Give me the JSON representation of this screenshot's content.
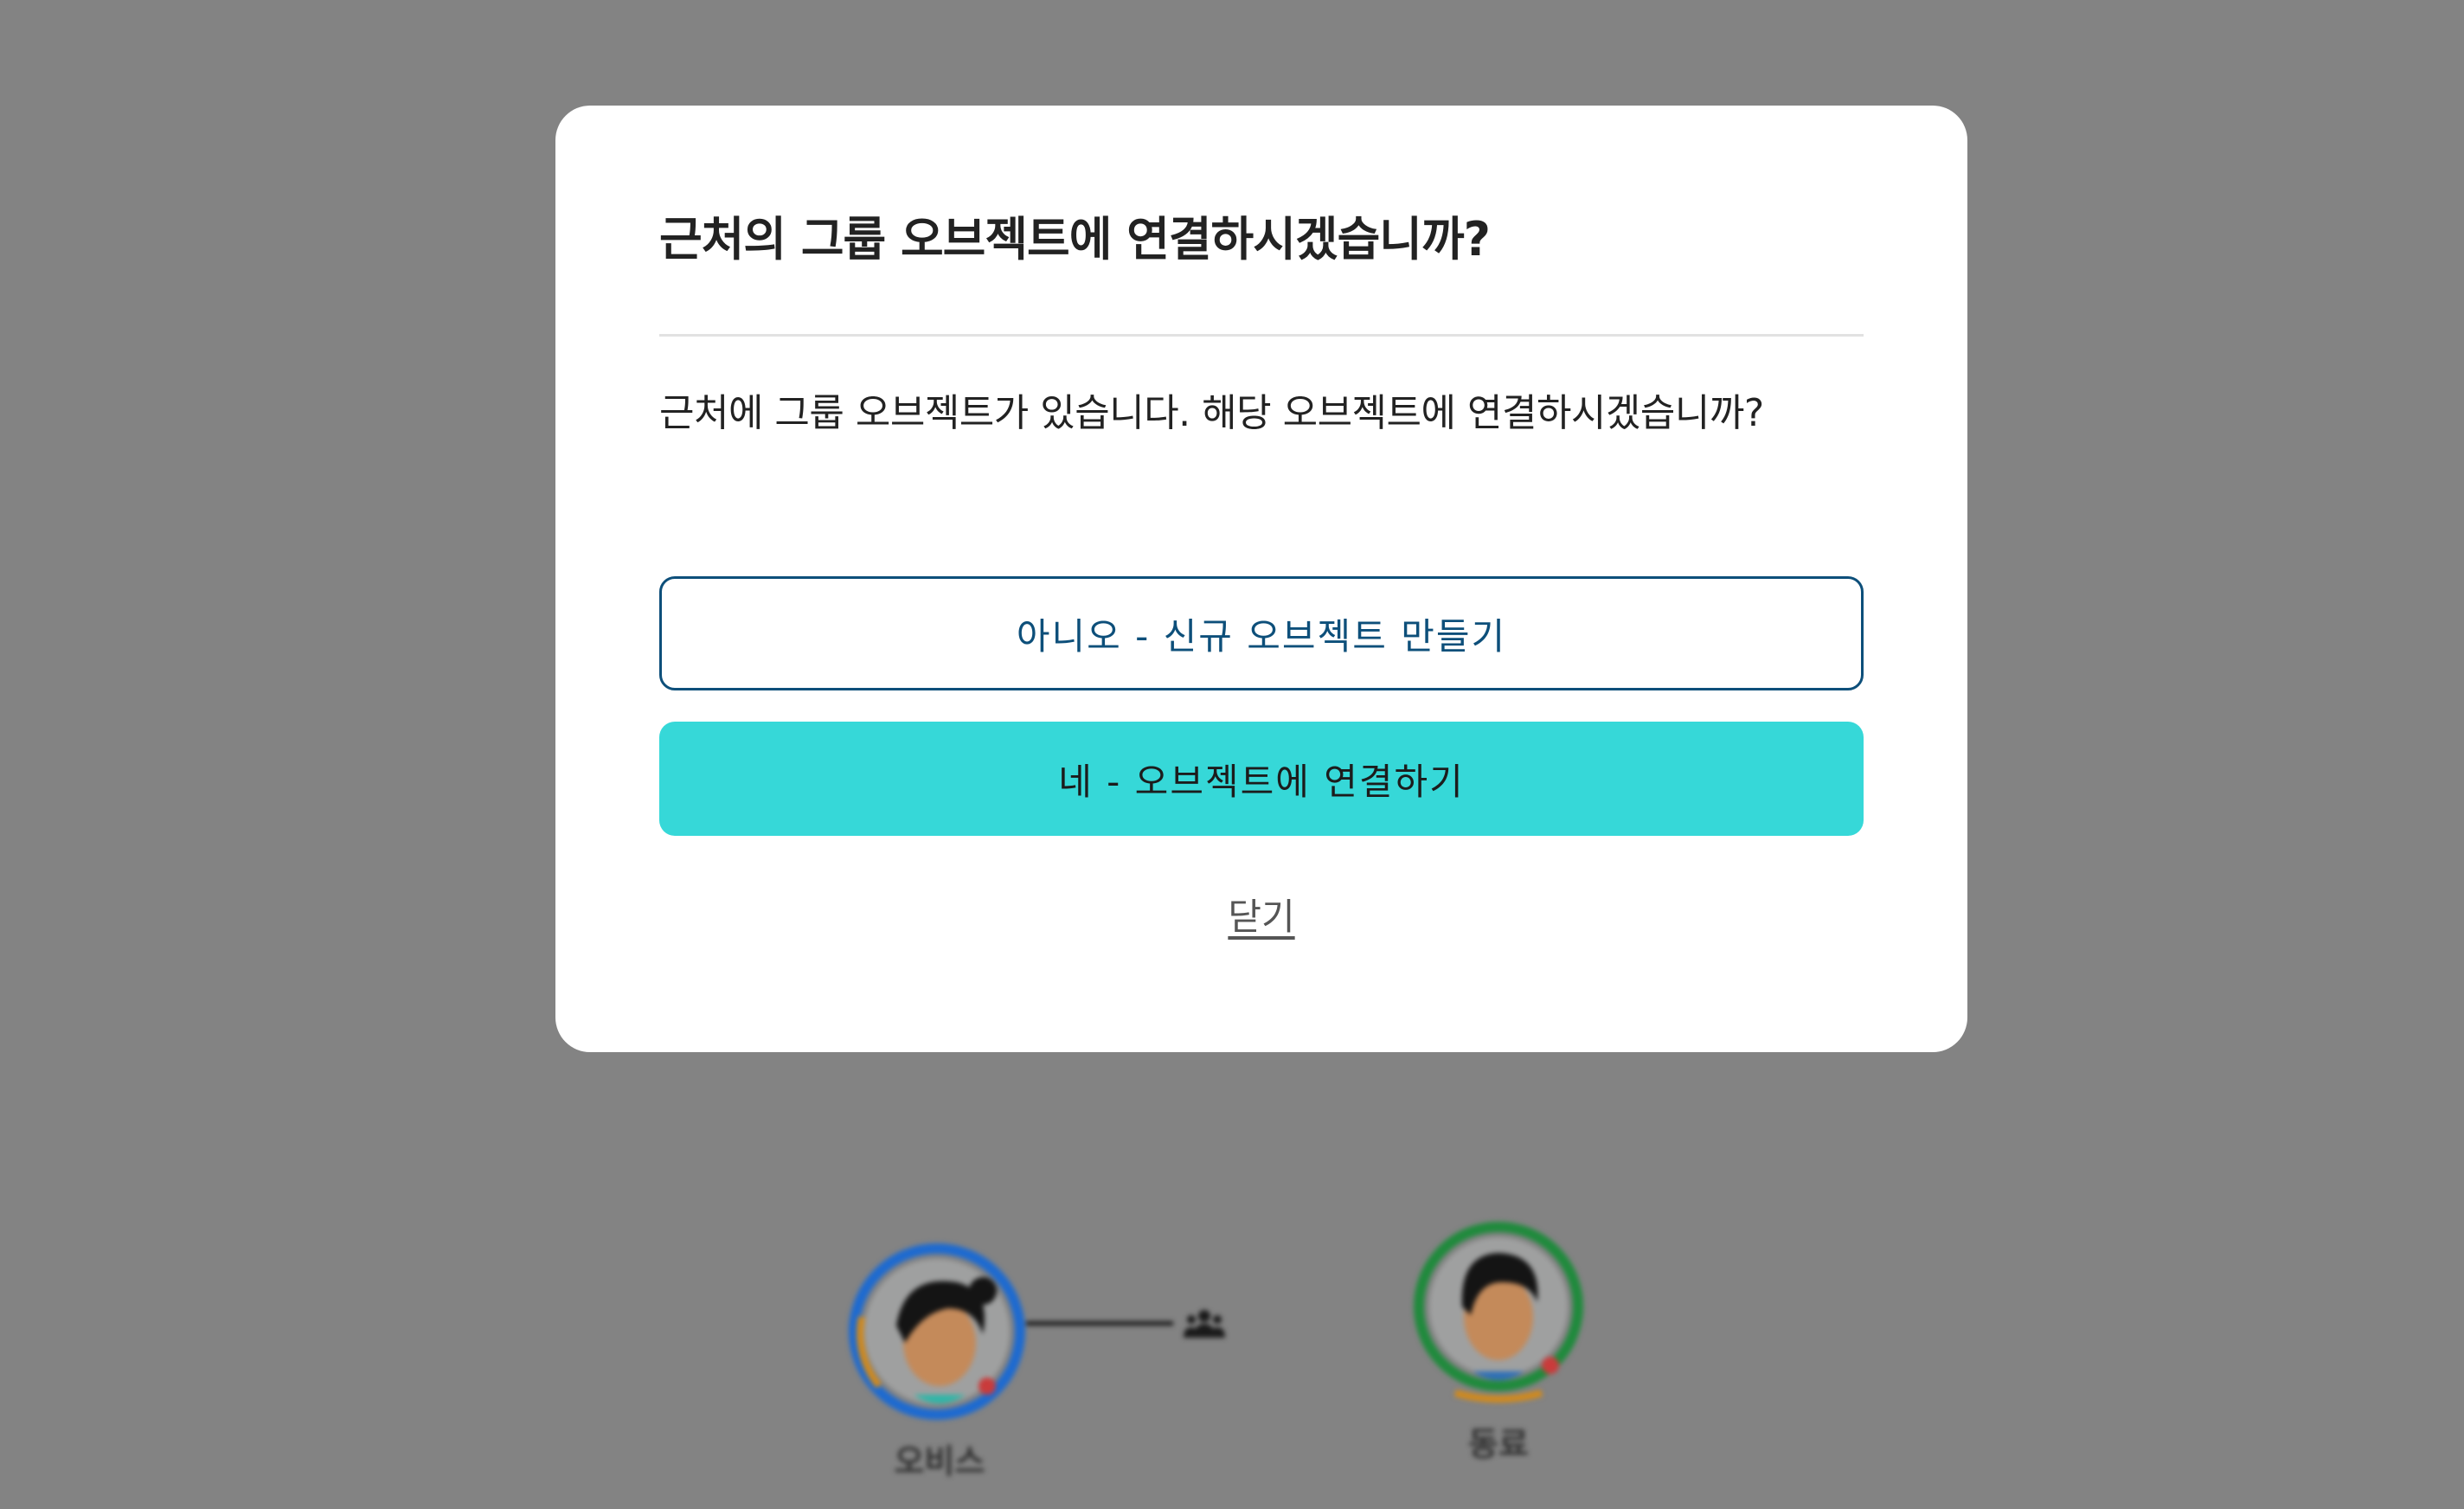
{
  "dialog": {
    "title": "근처의 그룹 오브젝트에 연결하시겠습니까?",
    "message": "근처에 그룹 오브젝트가 있습니다. 해당 오브젝트에 연결하시겠습니까?",
    "secondary_button_label": "아니오 - 신규 오브젝트 만들기",
    "primary_button_label": "네 - 오브젝트에 연결하기",
    "close_label": "닫기"
  },
  "background": {
    "people": [
      {
        "name": "오비스",
        "ring_color": "#1d6ad0",
        "accent_color": "#d38a1a"
      },
      {
        "name": "동료",
        "ring_color": "#1f8a3c",
        "accent_color": "#d38a1a"
      }
    ],
    "group_icon": "group-people-icon"
  },
  "colors": {
    "overlay": "#838383",
    "primary": "#36d8d8",
    "outline": "#0d4f7a"
  }
}
